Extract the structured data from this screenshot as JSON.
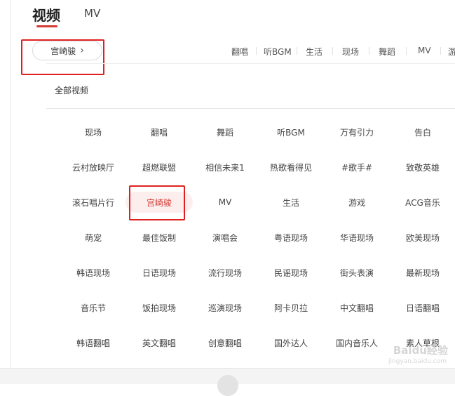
{
  "tabs": [
    {
      "label": "视频",
      "active": true
    },
    {
      "label": "MV",
      "active": false
    }
  ],
  "category_button": {
    "label": "宫崎骏"
  },
  "quick_tags": [
    "翻唱",
    "听BGM",
    "生活",
    "现场",
    "舞蹈",
    "MV",
    "游"
  ],
  "all_videos_label": "全部视频",
  "categories": [
    [
      "现场",
      "翻唱",
      "舞蹈",
      "听BGM",
      "万有引力",
      "告白"
    ],
    [
      "云村放映厅",
      "超燃联盟",
      "相信未来1",
      "热歌看得见",
      "#歌手#",
      "致敬英雄"
    ],
    [
      "滚石唱片行",
      "宫崎骏",
      "MV",
      "生活",
      "游戏",
      "ACG音乐"
    ],
    [
      "萌宠",
      "最佳饭制",
      "演唱会",
      "粤语现场",
      "华语现场",
      "欧美现场"
    ],
    [
      "韩语现场",
      "日语现场",
      "流行现场",
      "民谣现场",
      "街头表演",
      "最新现场"
    ],
    [
      "音乐节",
      "饭拍现场",
      "巡演现场",
      "阿卡贝拉",
      "中文翻唱",
      "日语翻唱"
    ],
    [
      "韩语翻唱",
      "英文翻唱",
      "创意翻唱",
      "国外达人",
      "国内音乐人",
      "素人草根"
    ]
  ],
  "selected_category": "宫崎骏",
  "watermark": {
    "brand": "Baidu经验",
    "url": "jingyan.baidu.com"
  },
  "colors": {
    "accent": "#d33a31",
    "highlight_box": "#e02020",
    "selected_bg": "#fdeeee"
  }
}
